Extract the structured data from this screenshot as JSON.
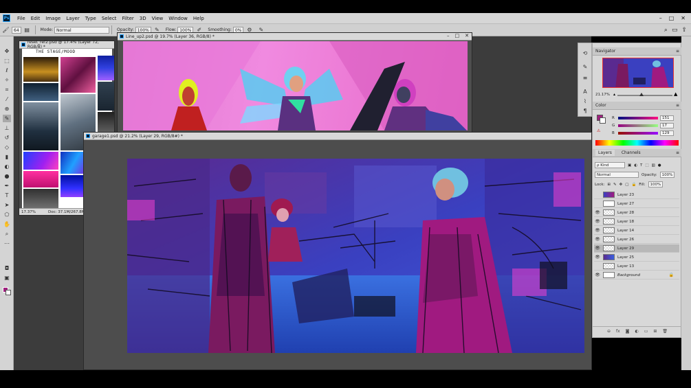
{
  "menubar": {
    "logo": "Ps",
    "items": [
      "File",
      "Edit",
      "Image",
      "Layer",
      "Type",
      "Select",
      "Filter",
      "3D",
      "View",
      "Window",
      "Help"
    ],
    "window_controls": [
      "–",
      "□",
      "✕"
    ]
  },
  "options": {
    "brush_size": "64",
    "mode_label": "Mode:",
    "mode_value": "Normal",
    "opacity_label": "Opacity:",
    "opacity_value": "100%",
    "flow_label": "Flow:",
    "flow_value": "100%",
    "smoothing_label": "Smoothing:",
    "smoothing_value": "0%",
    "right_icons": [
      "search-icon",
      "workspace-icon",
      "share-icon"
    ]
  },
  "toolbox": {
    "tools": [
      "move",
      "marquee",
      "lasso",
      "quick-select",
      "crop",
      "eyedropper",
      "healing",
      "brush",
      "stamp",
      "history-brush",
      "eraser",
      "gradient",
      "blur",
      "dodge",
      "pen",
      "type",
      "path-select",
      "shape",
      "hand",
      "zoom",
      "more"
    ],
    "active_tool": "brush",
    "foreground_color": "#a0207f",
    "background_color": "#ffffff"
  },
  "documents": {
    "ref": {
      "title": "reset_ref2.psd @ 17.4% (Layer 72, RGB/8) *",
      "board_title": "THE STAGE/MOOD",
      "zoom": "17.37%",
      "doc_size": "Doc: 37.1M/267.8M"
    },
    "lineup": {
      "title": "Line_up2.psd @ 19.7% (Layer 36, RGB/8) *"
    },
    "main": {
      "title": "garage1.psd @ 21.2% (Layer 29, RGB/8#) *"
    }
  },
  "navigator": {
    "title": "Navigator",
    "zoom": "21.17%"
  },
  "color": {
    "title": "Color",
    "r_label": "R",
    "r": "151",
    "g_label": "G",
    "g": "17",
    "b_label": "B",
    "b": "129",
    "foreground": "#a0207f"
  },
  "layers": {
    "tabs": [
      "Layers",
      "Channels"
    ],
    "kind_label": "ρ Kind",
    "blend_mode": "Normal",
    "opacity_label": "Opacity:",
    "opacity": "100%",
    "lock_label": "Lock:",
    "fill_label": "Fill:",
    "fill": "100%",
    "items": [
      {
        "name": "Layer 23",
        "visible": false,
        "selected": false,
        "thumb": "color"
      },
      {
        "name": "Layer 27",
        "visible": false,
        "selected": false,
        "thumb": "white"
      },
      {
        "name": "Layer 28",
        "visible": true,
        "selected": false,
        "thumb": "checker"
      },
      {
        "name": "Layer 18",
        "visible": true,
        "selected": false,
        "thumb": "checker"
      },
      {
        "name": "Layer 14",
        "visible": true,
        "selected": false,
        "thumb": "checker"
      },
      {
        "name": "Layer 26",
        "visible": true,
        "selected": false,
        "thumb": "checker"
      },
      {
        "name": "Layer 29",
        "visible": true,
        "selected": true,
        "thumb": "checker"
      },
      {
        "name": "Layer 25",
        "visible": true,
        "selected": false,
        "thumb": "color"
      },
      {
        "name": "Layer 13",
        "visible": false,
        "selected": false,
        "thumb": "checker"
      },
      {
        "name": "Background",
        "visible": true,
        "selected": false,
        "thumb": "white",
        "locked": true
      }
    ],
    "footer_icons": [
      "link-icon",
      "fx-icon",
      "mask-icon",
      "adjustment-icon",
      "group-icon",
      "new-layer-icon",
      "trash-icon"
    ]
  }
}
